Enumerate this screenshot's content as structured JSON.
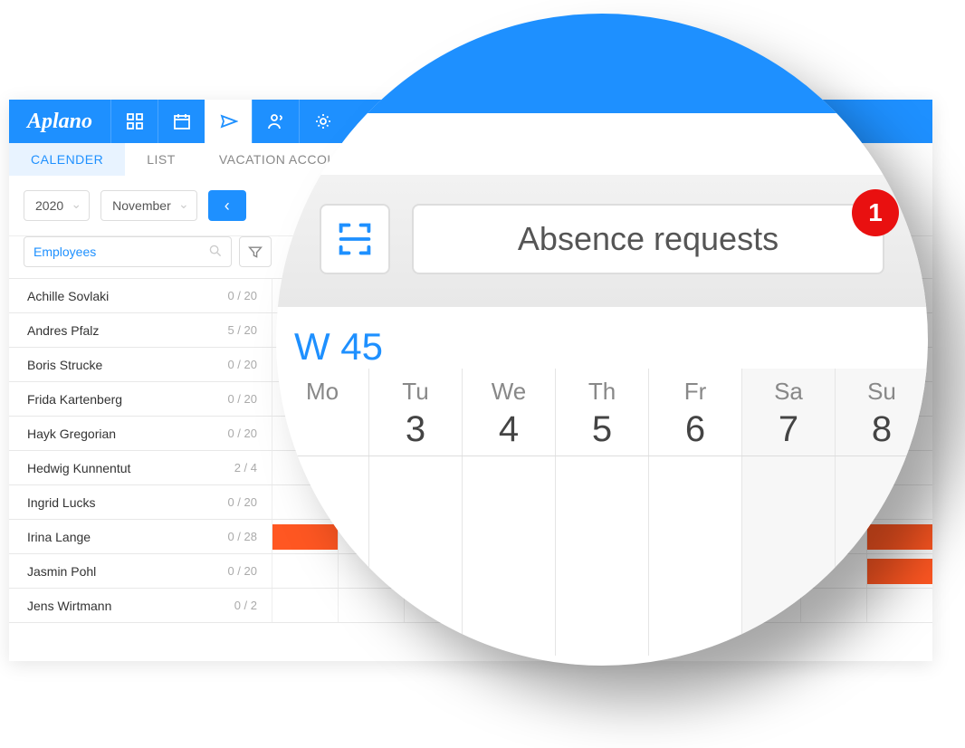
{
  "app": {
    "logo": "Aplano",
    "tabs": {
      "calendar": "CALENDER",
      "list": "LIST",
      "vacation": "VACATION ACCOL"
    },
    "year": "2020",
    "month": "November",
    "search_placeholder": "Employees",
    "employees": [
      {
        "name": "Achille Sovlaki",
        "count": "0 / 20"
      },
      {
        "name": "Andres Pfalz",
        "count": "5 / 20"
      },
      {
        "name": "Boris Strucke",
        "count": "0 / 20"
      },
      {
        "name": "Frida Kartenberg",
        "count": "0 / 20"
      },
      {
        "name": "Hayk Gregorian",
        "count": "0 / 20"
      },
      {
        "name": "Hedwig Kunnentut",
        "count": "2 / 4"
      },
      {
        "name": "Ingrid Lucks",
        "count": "0 / 20"
      },
      {
        "name": "Irina Lange",
        "count": "0 / 28"
      },
      {
        "name": "Jasmin Pohl",
        "count": "0 / 20"
      },
      {
        "name": "Jens Wirtmann",
        "count": "0 / 2"
      }
    ]
  },
  "zoom": {
    "absence_label": "Absence requests",
    "badge": "1",
    "week_label": "W 45",
    "days": [
      {
        "abbr": "Mo",
        "date": ""
      },
      {
        "abbr": "Tu",
        "date": "3"
      },
      {
        "abbr": "We",
        "date": "4"
      },
      {
        "abbr": "Th",
        "date": "5"
      },
      {
        "abbr": "Fr",
        "date": "6"
      },
      {
        "abbr": "Sa",
        "date": "7"
      },
      {
        "abbr": "Su",
        "date": "8"
      }
    ]
  }
}
